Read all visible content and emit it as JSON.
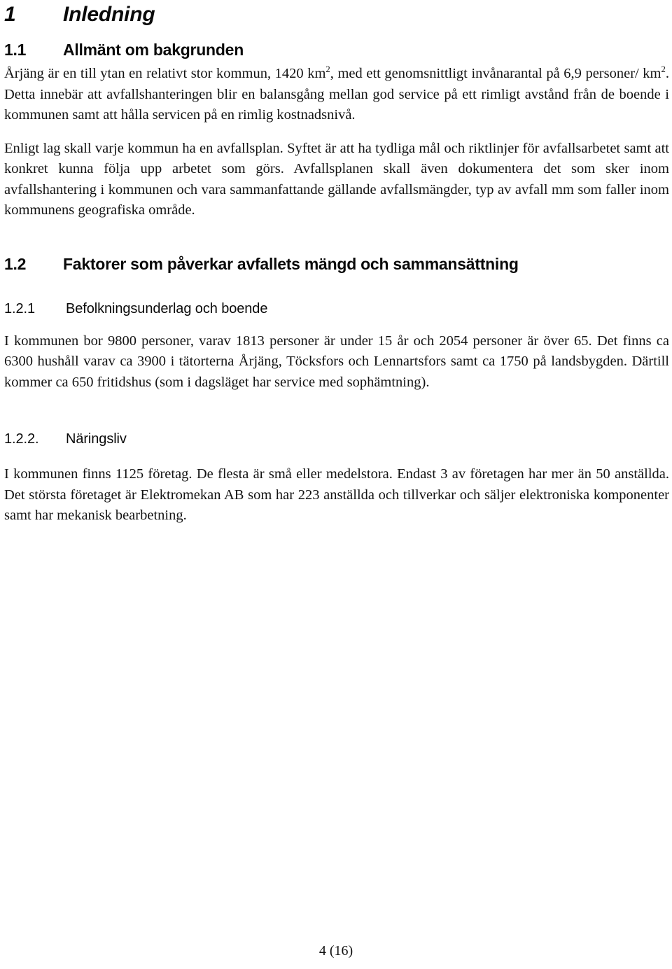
{
  "document": {
    "language": "sv",
    "footer": {
      "page_label": "4 (16)"
    }
  },
  "sections": {
    "h1": {
      "number": "1",
      "title": "Inledning"
    },
    "h2_1_1": {
      "number": "1.1",
      "title": "Allmänt om bakgrunden"
    },
    "h2_1_2": {
      "number": "1.2",
      "title": "Faktorer som påverkar avfallets mängd och sammansättning"
    },
    "h3_1_2_1": {
      "number": "1.2.1",
      "title": "Befolkningsunderlag och boende"
    },
    "h3_1_2_2": {
      "number": "1.2.2.",
      "title": "Näringsliv"
    }
  },
  "paragraphs": {
    "intro_bakgrund": {
      "part1": "Årjäng är en till ytan en relativt stor kommun, 1420 km",
      "sup1": "2",
      "part2": ", med ett genomsnittligt invånarantal på 6,9 personer/ km",
      "sup2": "2",
      "part3": ". Detta innebär att avfallshanteringen blir en balansgång mellan god service på ett rimligt avstånd från de boende i kommunen samt att hålla servicen på en rimlig kostnadsnivå."
    },
    "avfallsplan": "Enligt lag skall varje kommun ha en avfallsplan. Syftet är att ha tydliga mål och riktlinjer för avfallsarbetet samt att konkret kunna följa upp arbetet som görs. Avfallsplanen skall även dokumentera det som sker inom avfallshantering i kommunen och vara sammanfattande gällande avfallsmängder, typ av avfall mm som faller inom kommunens geografiska område.",
    "befolkning": "I kommunen bor 9800 personer, varav 1813 personer är under 15 år och 2054 personer är över 65. Det finns ca 6300 hushåll varav  ca 3900 i tätorterna Årjäng, Töcksfors och Lennartsfors samt ca 1750 på landsbygden. Därtill kommer ca 650 fritidshus (som i dagsläget har service med sophämtning).",
    "naringsliv": "I kommunen finns 1125 företag. De flesta är små eller medelstora. Endast 3 av företagen har mer än 50 anställda. Det största företaget är Elektromekan AB som har  223 anställda och tillverkar och säljer elektroniska komponenter samt har mekanisk bearbetning."
  }
}
